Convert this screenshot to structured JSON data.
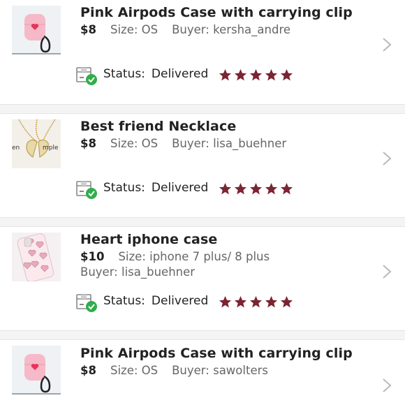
{
  "colors": {
    "star": "#7b2433",
    "check": "#2fae4b",
    "chevron": "#b9b9b9"
  },
  "orders": [
    {
      "title": "Pink Airpods Case with carrying clip",
      "price": "$8",
      "size": "Size: OS",
      "buyer": "Buyer: kersha_andre",
      "status_label": "Status:",
      "status_value": "Delivered",
      "rating": 5,
      "thumb_icon": "pink-airpods-case-image"
    },
    {
      "title": "Best friend Necklace",
      "price": "$8",
      "size": "Size: OS",
      "buyer": "Buyer: lisa_buehner",
      "status_label": "Status:",
      "status_value": "Delivered",
      "rating": 5,
      "thumb_icon": "necklace-image"
    },
    {
      "title": "Heart iphone case",
      "price": "$10",
      "size": "Size: iphone 7 plus/ 8 plus",
      "buyer": "Buyer: lisa_buehner",
      "status_label": "Status:",
      "status_value": "Delivered",
      "rating": 5,
      "thumb_icon": "heart-iphone-case-image"
    },
    {
      "title": "Pink Airpods Case with carrying clip",
      "price": "$8",
      "size": "Size: OS",
      "buyer": "Buyer: sawolters",
      "thumb_icon": "pink-airpods-case-image"
    }
  ]
}
